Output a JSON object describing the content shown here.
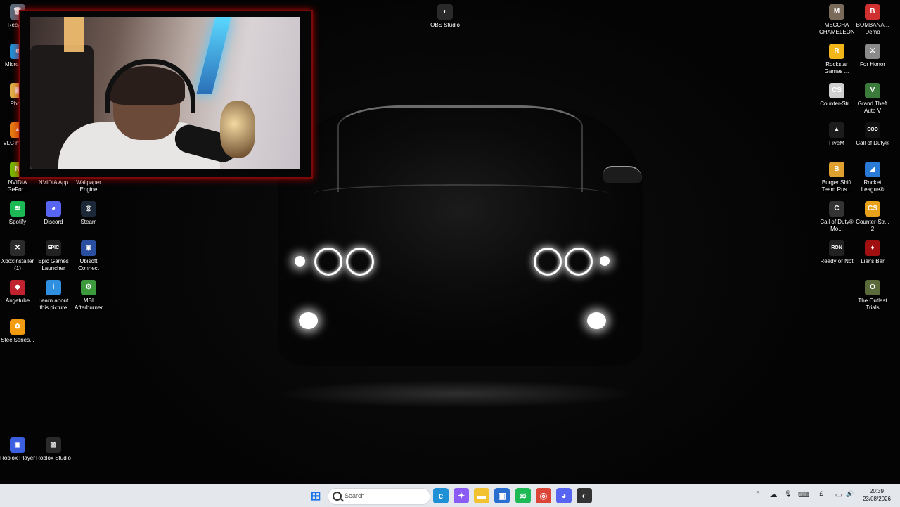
{
  "desktop": {
    "icons": [
      {
        "id": "recycle",
        "label": "Recycle",
        "glyph": "🗑",
        "color": "#5b6a7a"
      },
      {
        "id": "edge",
        "label": "Micro Edg",
        "glyph": "e",
        "color": "#1f8fd6"
      },
      {
        "id": "photos",
        "label": "Photo",
        "glyph": "▣",
        "color": "#e0b04a"
      },
      {
        "id": "vlc",
        "label": "VLC m play",
        "glyph": "▲",
        "color": "#e57b12"
      },
      {
        "id": "nvidia-geforce",
        "label": "NVIDIA GeFor...",
        "glyph": "N",
        "color": "#76b900"
      },
      {
        "id": "nvidia-app",
        "label": "NVIDIA App",
        "glyph": "N",
        "color": "#76b900"
      },
      {
        "id": "wallpaper-engine",
        "label": "Wallpaper Engine",
        "glyph": "W",
        "color": "#1a1a1a"
      },
      {
        "id": "spotify",
        "label": "Spotify",
        "glyph": "≋",
        "color": "#1db954"
      },
      {
        "id": "discord",
        "label": "Discord",
        "glyph": "◕",
        "color": "#5865f2"
      },
      {
        "id": "steam",
        "label": "Steam",
        "glyph": "◎",
        "color": "#1b2838"
      },
      {
        "id": "xbox-installer",
        "label": "XboxInstaller (1)",
        "glyph": "✕",
        "color": "#2b2b2b"
      },
      {
        "id": "epic",
        "label": "Epic Games Launcher",
        "glyph": "EPIC",
        "color": "#222222"
      },
      {
        "id": "ubisoft",
        "label": "Ubisoft Connect",
        "glyph": "◉",
        "color": "#2a4fa0"
      },
      {
        "id": "angetube",
        "label": "Angetube",
        "glyph": "◆",
        "color": "#c0222e"
      },
      {
        "id": "learn-picture",
        "label": "Learn about this picture",
        "glyph": "i",
        "color": "#2f8fe0"
      },
      {
        "id": "msi-afterburner",
        "label": "MSI Afterburner",
        "glyph": "⚙",
        "color": "#3c9a3c"
      },
      {
        "id": "steelseries",
        "label": "SteelSeries...",
        "glyph": "✿",
        "color": "#f39c12"
      },
      {
        "id": "roblox-player",
        "label": "Roblox Player",
        "glyph": "▣",
        "color": "#3b5fe0"
      },
      {
        "id": "roblox-studio",
        "label": "Roblox Studio",
        "glyph": "▨",
        "color": "#2a2a2a"
      },
      {
        "id": "obs",
        "label": "OBS Studio",
        "glyph": "◐",
        "color": "#2a2a2a"
      },
      {
        "id": "meccha",
        "label": "MECCHA CHAMELEON",
        "glyph": "M",
        "color": "#7a6a5a"
      },
      {
        "id": "bombana",
        "label": "BOMBANA... Demo",
        "glyph": "B",
        "color": "#d03030"
      },
      {
        "id": "rockstar",
        "label": "Rockstar Games ...",
        "glyph": "R",
        "color": "#f2b619"
      },
      {
        "id": "for-honor",
        "label": "For Honor",
        "glyph": "⚔",
        "color": "#8a8a8a"
      },
      {
        "id": "counter-strike",
        "label": "Counter-Str...",
        "glyph": "CS",
        "color": "#d0d0d0"
      },
      {
        "id": "gta-v",
        "label": "Grand Theft Auto V",
        "glyph": "V",
        "color": "#3a7a3a"
      },
      {
        "id": "fivem",
        "label": "FiveM",
        "glyph": "▲",
        "color": "#1c1c1c"
      },
      {
        "id": "cod",
        "label": "Call of Duty®",
        "glyph": "COD",
        "color": "#111111"
      },
      {
        "id": "burger-shift",
        "label": "Burger Shift Team Rus...",
        "glyph": "B",
        "color": "#e0a030"
      },
      {
        "id": "rocket-league",
        "label": "Rocket League®",
        "glyph": "◢",
        "color": "#2a7ad8"
      },
      {
        "id": "cod-mobile",
        "label": "Call of Duty® Mo...",
        "glyph": "C",
        "color": "#333333"
      },
      {
        "id": "counter-strike-2",
        "label": "Counter-Str... 2",
        "glyph": "CS",
        "color": "#e8a11a"
      },
      {
        "id": "ready-or-not",
        "label": "Ready or Not",
        "glyph": "RON",
        "color": "#222222"
      },
      {
        "id": "liars-bar",
        "label": "Liar's Bar",
        "glyph": "♦",
        "color": "#a01010"
      },
      {
        "id": "outlast-trials",
        "label": "The Outlast Trials",
        "glyph": "O",
        "color": "#5a6a3a"
      }
    ]
  },
  "taskbar": {
    "search_placeholder": "Search",
    "apps": [
      {
        "id": "start",
        "glyph": "⊞",
        "color": "#1a73e8"
      },
      {
        "id": "edge",
        "glyph": "e",
        "color": "#1f8fd6"
      },
      {
        "id": "copilot",
        "glyph": "✦",
        "color": "#8a5cf5"
      },
      {
        "id": "file-explorer",
        "glyph": "▬",
        "color": "#f2c230"
      },
      {
        "id": "store",
        "glyph": "▣",
        "color": "#2a6fd0"
      },
      {
        "id": "spotify",
        "glyph": "≋",
        "color": "#1db954"
      },
      {
        "id": "chrome",
        "glyph": "◎",
        "color": "#db4437"
      },
      {
        "id": "discord",
        "glyph": "◕",
        "color": "#5865f2"
      },
      {
        "id": "obs",
        "glyph": "◐",
        "color": "#333333"
      }
    ],
    "tray": {
      "chevron": "^",
      "onedrive": "☁",
      "mic": "🎙",
      "keyboard": "⌨",
      "currency": "£",
      "network": "▭",
      "volume": "🔊"
    },
    "clock": {
      "time": "20:39",
      "date": "23/08/2026"
    }
  }
}
